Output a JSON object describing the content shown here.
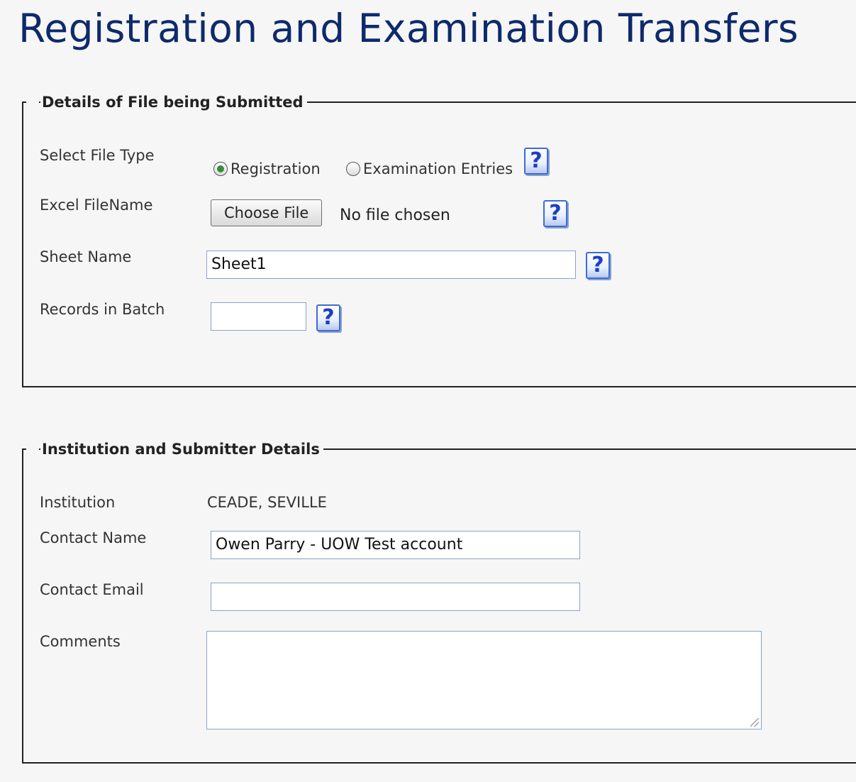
{
  "page": {
    "title": "Registration and Examination Transfers"
  },
  "file_section": {
    "legend": "Details of File being Submitted",
    "file_type": {
      "label": "Select File Type",
      "options": [
        "Registration",
        "Examination Entries"
      ],
      "selected": "Registration"
    },
    "excel_file": {
      "label": "Excel FileName",
      "button_label": "Choose File",
      "status": "No file chosen"
    },
    "sheet_name": {
      "label": "Sheet Name",
      "value": "Sheet1"
    },
    "records": {
      "label": "Records in Batch",
      "value": ""
    },
    "help_glyph": "?"
  },
  "institution_section": {
    "legend": "Institution and Submitter Details",
    "institution": {
      "label": "Institution",
      "value": "CEADE, SEVILLE"
    },
    "contact_name": {
      "label": "Contact Name",
      "value": "Owen Parry - UOW Test account"
    },
    "contact_email": {
      "label": "Contact Email",
      "value": ""
    },
    "comments": {
      "label": "Comments",
      "value": ""
    }
  }
}
